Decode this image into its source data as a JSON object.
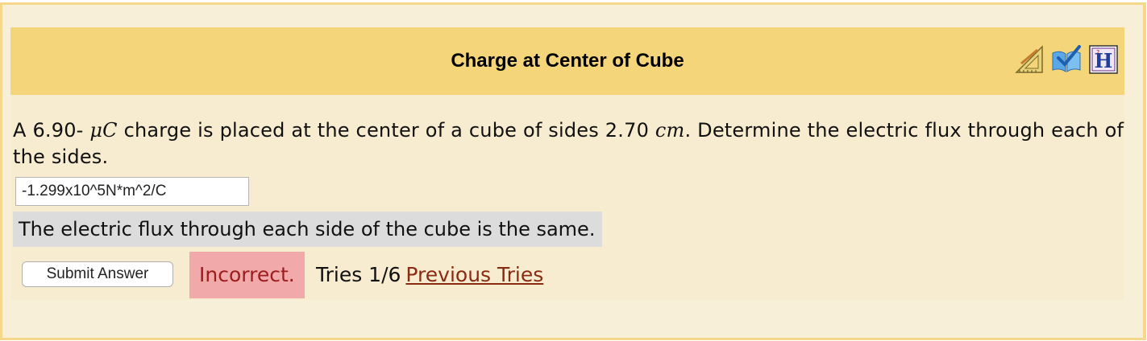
{
  "problem": {
    "title": "Charge at Center of Cube",
    "icons": [
      "tools-icon",
      "feedback-icon",
      "help-icon"
    ],
    "question": {
      "prefix": "A 6.90- ",
      "unit_charge": "μC",
      "middle": " charge is placed at the center of a cube of sides 2.70 ",
      "unit_length": "cm",
      "suffix": ". Determine the electric flux through each of the sides."
    },
    "answer_value": "-1.299x10^5N*m^2/C",
    "hint": "The electric flux through each side of the cube is the same.",
    "submit_label": "Submit Answer",
    "status": "Incorrect.",
    "tries": "Tries 1/6",
    "previous_tries_label": "Previous Tries"
  },
  "colors": {
    "header": "#f5d57a",
    "panel": "#f7ecd0",
    "border": "#f5d88a",
    "incorrect_bg": "#f2a9a9",
    "incorrect_text": "#9b1d1d",
    "link": "#8a2a12"
  }
}
